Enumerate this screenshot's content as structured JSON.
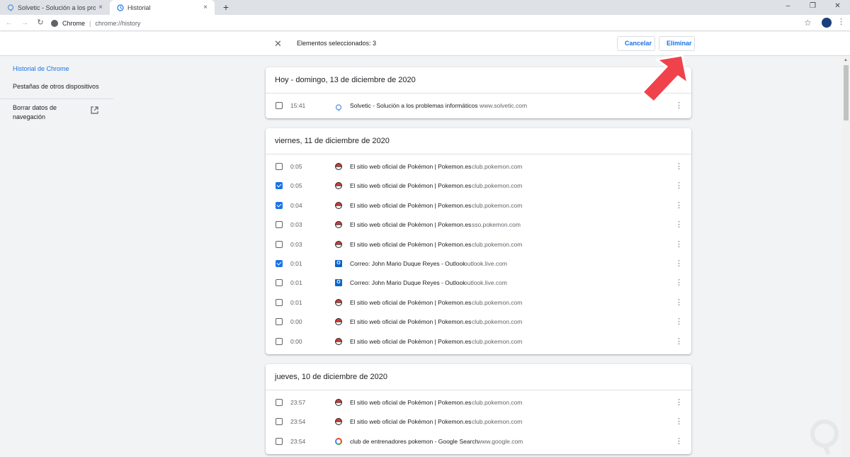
{
  "tabs": [
    {
      "title": "Solvetic - Solución a los problema",
      "close": "×"
    },
    {
      "title": "Historial",
      "close": "×"
    }
  ],
  "newtab_symbol": "+",
  "window_controls": {
    "minimize": "–",
    "restore": "❐",
    "close": "✕"
  },
  "toolbar": {
    "back": "←",
    "forward": "→",
    "reload": "↻",
    "site": "Chrome",
    "separator": "|",
    "url": "chrome://history",
    "star": "☆",
    "menu": "⋮"
  },
  "selection": {
    "close": "✕",
    "count_text": "Elementos seleccionados: 3",
    "cancel_label": "Cancelar",
    "delete_label": "Eliminar"
  },
  "sidebar": {
    "items": [
      "Historial de Chrome",
      "Pestañas de otros dispositivos"
    ],
    "clear_line1": "Borrar datos de",
    "clear_line2": "navegación"
  },
  "more_symbol": "⋮",
  "days": [
    {
      "title": "Hoy - domingo, 13 de diciembre de 2020",
      "entries": [
        {
          "time": "15:41",
          "title": "Solvetic - Solución a los problemas informáticos",
          "domain": "www.solvetic.com",
          "icon": "solvetic-icon",
          "checked": false
        }
      ]
    },
    {
      "title": "viernes, 11 de diciembre de 2020",
      "entries": [
        {
          "time": "0:05",
          "title": "El sitio web oficial de Pokémon | Pokemon.es",
          "domain": "club.pokemon.com",
          "icon": "pokeball-icon",
          "checked": false
        },
        {
          "time": "0:05",
          "title": "El sitio web oficial de Pokémon | Pokemon.es",
          "domain": "club.pokemon.com",
          "icon": "pokeball-icon",
          "checked": true
        },
        {
          "time": "0:04",
          "title": "El sitio web oficial de Pokémon | Pokemon.es",
          "domain": "club.pokemon.com",
          "icon": "pokeball-icon",
          "checked": true
        },
        {
          "time": "0:03",
          "title": "El sitio web oficial de Pokémon | Pokemon.es",
          "domain": "sso.pokemon.com",
          "icon": "pokeball-icon",
          "checked": false
        },
        {
          "time": "0:03",
          "title": "El sitio web oficial de Pokémon | Pokemon.es",
          "domain": "club.pokemon.com",
          "icon": "pokeball-icon",
          "checked": false
        },
        {
          "time": "0:01",
          "title": "Correo: John Mario Duque Reyes - Outlook",
          "domain": "outlook.live.com",
          "icon": "outlook-icon",
          "checked": true
        },
        {
          "time": "0:01",
          "title": "Correo: John Mario Duque Reyes - Outlook",
          "domain": "outlook.live.com",
          "icon": "outlook-icon",
          "checked": false
        },
        {
          "time": "0:01",
          "title": "El sitio web oficial de Pokémon | Pokemon.es",
          "domain": "club.pokemon.com",
          "icon": "pokeball-icon",
          "checked": false
        },
        {
          "time": "0:00",
          "title": "El sitio web oficial de Pokémon | Pokemon.es",
          "domain": "club.pokemon.com",
          "icon": "pokeball-icon",
          "checked": false
        },
        {
          "time": "0:00",
          "title": "El sitio web oficial de Pokémon | Pokemon.es",
          "domain": "club.pokemon.com",
          "icon": "pokeball-icon",
          "checked": false
        }
      ]
    },
    {
      "title": "jueves, 10 de diciembre de 2020",
      "entries": [
        {
          "time": "23:57",
          "title": "El sitio web oficial de Pokémon | Pokemon.es",
          "domain": "club.pokemon.com",
          "icon": "pokeball-icon",
          "checked": false
        },
        {
          "time": "23:54",
          "title": "El sitio web oficial de Pokémon | Pokemon.es",
          "domain": "club.pokemon.com",
          "icon": "pokeball-icon",
          "checked": false
        },
        {
          "time": "23:54",
          "title": "club de entrenadores pokemon - Google Search",
          "domain": "www.google.com",
          "icon": "google-icon",
          "checked": false
        }
      ]
    }
  ],
  "colors": {
    "accent": "#1a73e8",
    "arrow": "#f0424a",
    "background": "#f1f3f4"
  }
}
